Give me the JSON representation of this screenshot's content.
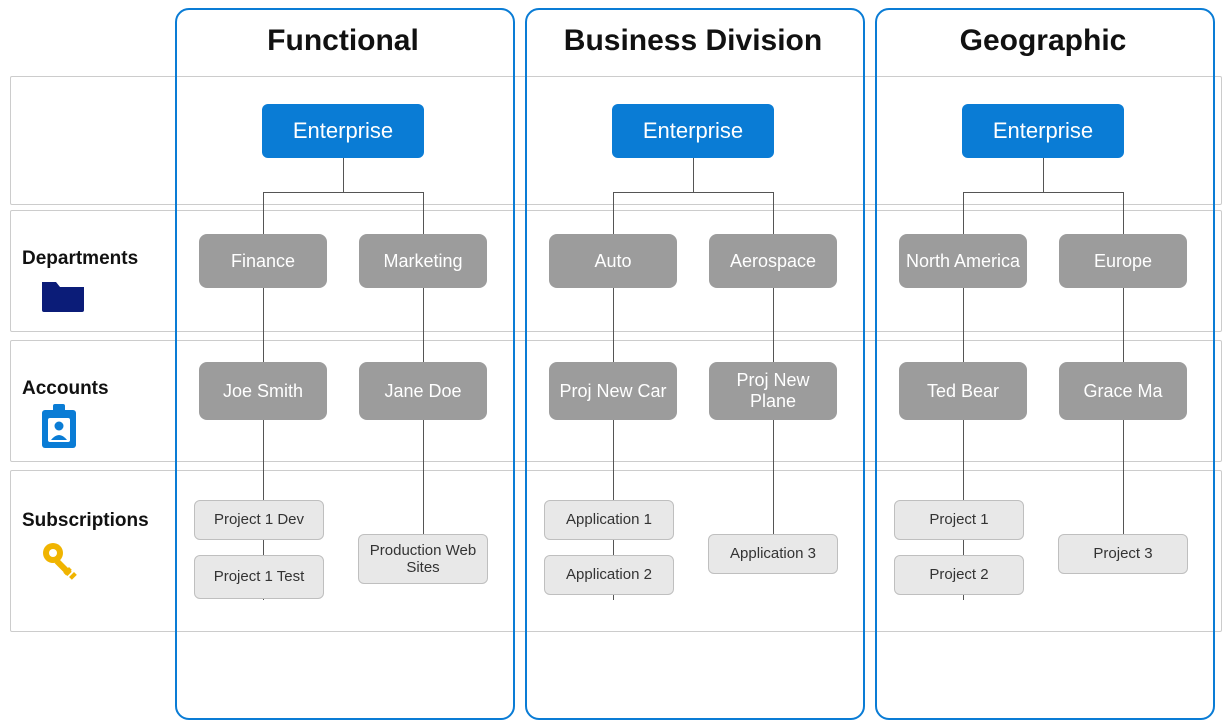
{
  "columns": [
    {
      "key": "functional",
      "title": "Functional"
    },
    {
      "key": "business",
      "title": "Business Division"
    },
    {
      "key": "geographic",
      "title": "Geographic"
    }
  ],
  "rows": [
    {
      "key": "departments",
      "label": "Departments"
    },
    {
      "key": "accounts",
      "label": "Accounts"
    },
    {
      "key": "subscriptions",
      "label": "Subscriptions"
    }
  ],
  "enterprise_label": "Enterprise",
  "hierarchies": {
    "functional": {
      "departments": [
        "Finance",
        "Marketing"
      ],
      "accounts": [
        "Joe Smith",
        "Jane Doe"
      ],
      "subscriptions_left": [
        "Project 1 Dev",
        "Project 1 Test"
      ],
      "subscriptions_right": [
        "Production Web Sites"
      ]
    },
    "business": {
      "departments": [
        "Auto",
        "Aerospace"
      ],
      "accounts": [
        "Proj New Car",
        "Proj New Plane"
      ],
      "subscriptions_left": [
        "Application 1",
        "Application 2"
      ],
      "subscriptions_right": [
        "Application 3"
      ]
    },
    "geographic": {
      "departments": [
        "North America",
        "Europe"
      ],
      "accounts": [
        "Ted Bear",
        "Grace Ma"
      ],
      "subscriptions_left": [
        "Project 1",
        "Project 2"
      ],
      "subscriptions_right": [
        "Project 3"
      ]
    }
  },
  "colors": {
    "enterprise": "#0a7cd5",
    "dept": "#9c9c9c",
    "sub_bg": "#e8e8e8",
    "frame": "#0a7cd5",
    "dept_icon": "#0b1c78",
    "acct_icon": "#0a7cd5",
    "sub_icon": "#f0b400"
  }
}
